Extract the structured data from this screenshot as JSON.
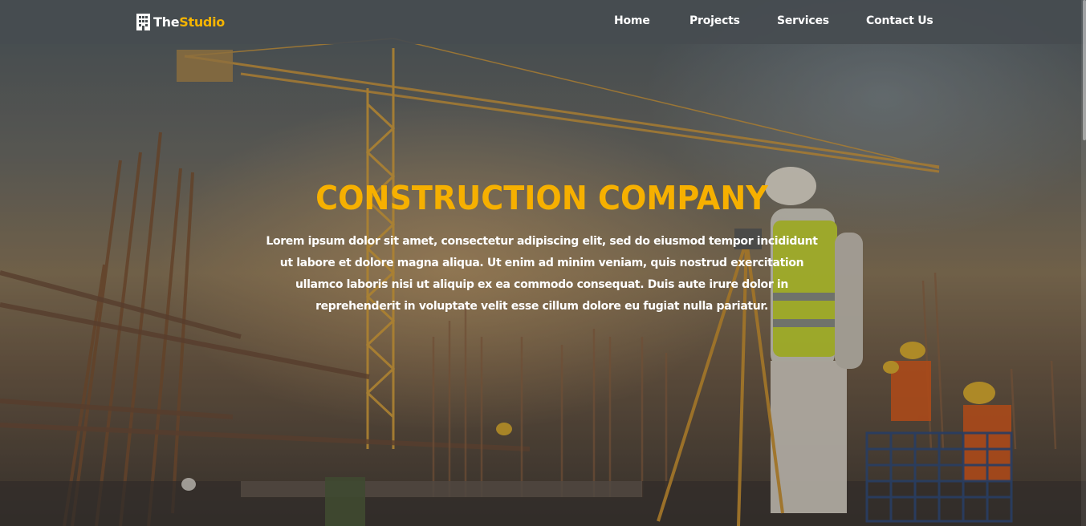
{
  "navbar": {
    "brand_the": "The",
    "brand_studio": "Studio",
    "links": [
      {
        "label": "Home"
      },
      {
        "label": "Projects"
      },
      {
        "label": "Services"
      },
      {
        "label": "Contact Us"
      }
    ]
  },
  "hero": {
    "title": "CONSTRUCTION COMPANY",
    "description": "Lorem ipsum dolor sit amet, consectetur adipiscing elit, sed do eiusmod tempor incididunt ut labore et dolore magna aliqua. Ut enim ad minim veniam, quis nostrud exercitation ullamco laboris nisi ut aliquip ex ea commodo consequat. Duis aute irure dolor in reprehenderit in voluptate velit esse cillum dolore eu fugiat nulla pariatur.",
    "background_image": "construction-site-photo"
  },
  "icons": {
    "brand": "building-icon"
  },
  "colors": {
    "accent": "#f5b400",
    "navbar_bg": "#464c50",
    "text": "#ffffff"
  }
}
